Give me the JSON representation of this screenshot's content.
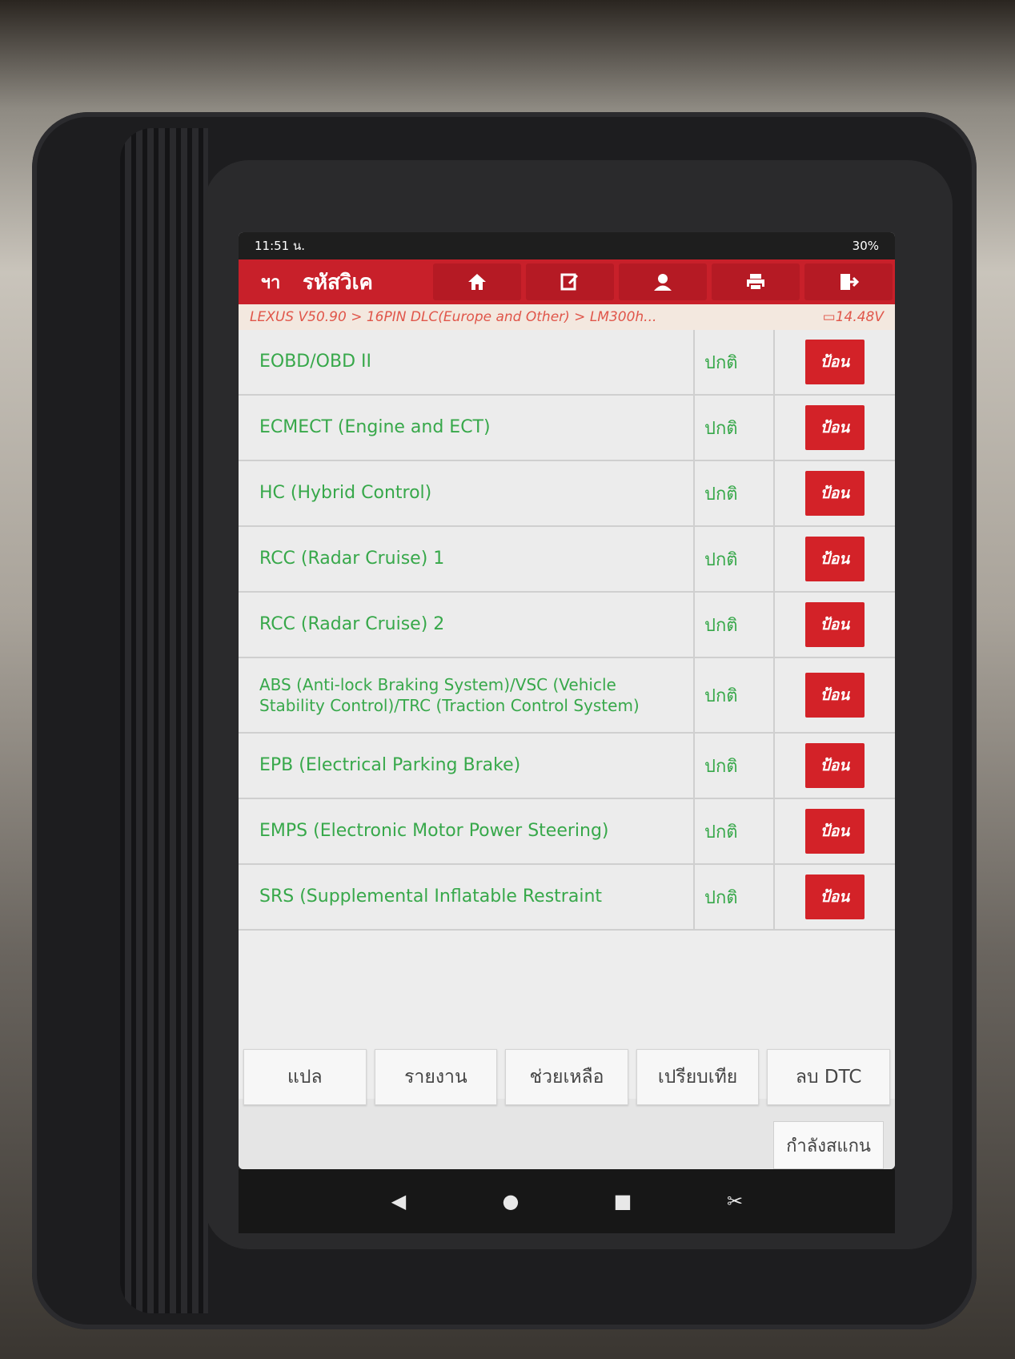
{
  "status": {
    "time": "11:51 น.",
    "battery": "30%"
  },
  "toolbar": {
    "back_label": "ฯา",
    "title": "รหัสวิเค"
  },
  "breadcrumb": {
    "path": "LEXUS V50.90 > 16PIN DLC(Europe and Other) > LM300h...",
    "voltage": "14.48V"
  },
  "rows": [
    {
      "name": "EOBD/OBD II",
      "status": "ปกติ",
      "button": "ป้อน"
    },
    {
      "name": "ECMECT (Engine and ECT)",
      "status": "ปกติ",
      "button": "ป้อน"
    },
    {
      "name": "HC (Hybrid Control)",
      "status": "ปกติ",
      "button": "ป้อน"
    },
    {
      "name": "RCC (Radar Cruise) 1",
      "status": "ปกติ",
      "button": "ป้อน"
    },
    {
      "name": "RCC (Radar Cruise) 2",
      "status": "ปกติ",
      "button": "ป้อน"
    },
    {
      "name": "ABS (Anti-lock Braking System)/VSC (Vehicle Stability Control)/TRC (Traction Control System)",
      "status": "ปกติ",
      "button": "ป้อน"
    },
    {
      "name": "EPB (Electrical Parking Brake)",
      "status": "ปกติ",
      "button": "ป้อน"
    },
    {
      "name": "EMPS (Electronic Motor Power Steering)",
      "status": "ปกติ",
      "button": "ป้อน"
    },
    {
      "name": "SRS (Supplemental Inflatable Restraint",
      "status": "ปกติ",
      "button": "ป้อน"
    }
  ],
  "actions": [
    "แปล",
    "รายงาน",
    "ช่วยเหลือ",
    "เปรียบเทีย",
    "ลบ DTC"
  ],
  "scan_label": "กำลังสแกน",
  "accent": "#c8202a",
  "text_green": "#37a84a"
}
